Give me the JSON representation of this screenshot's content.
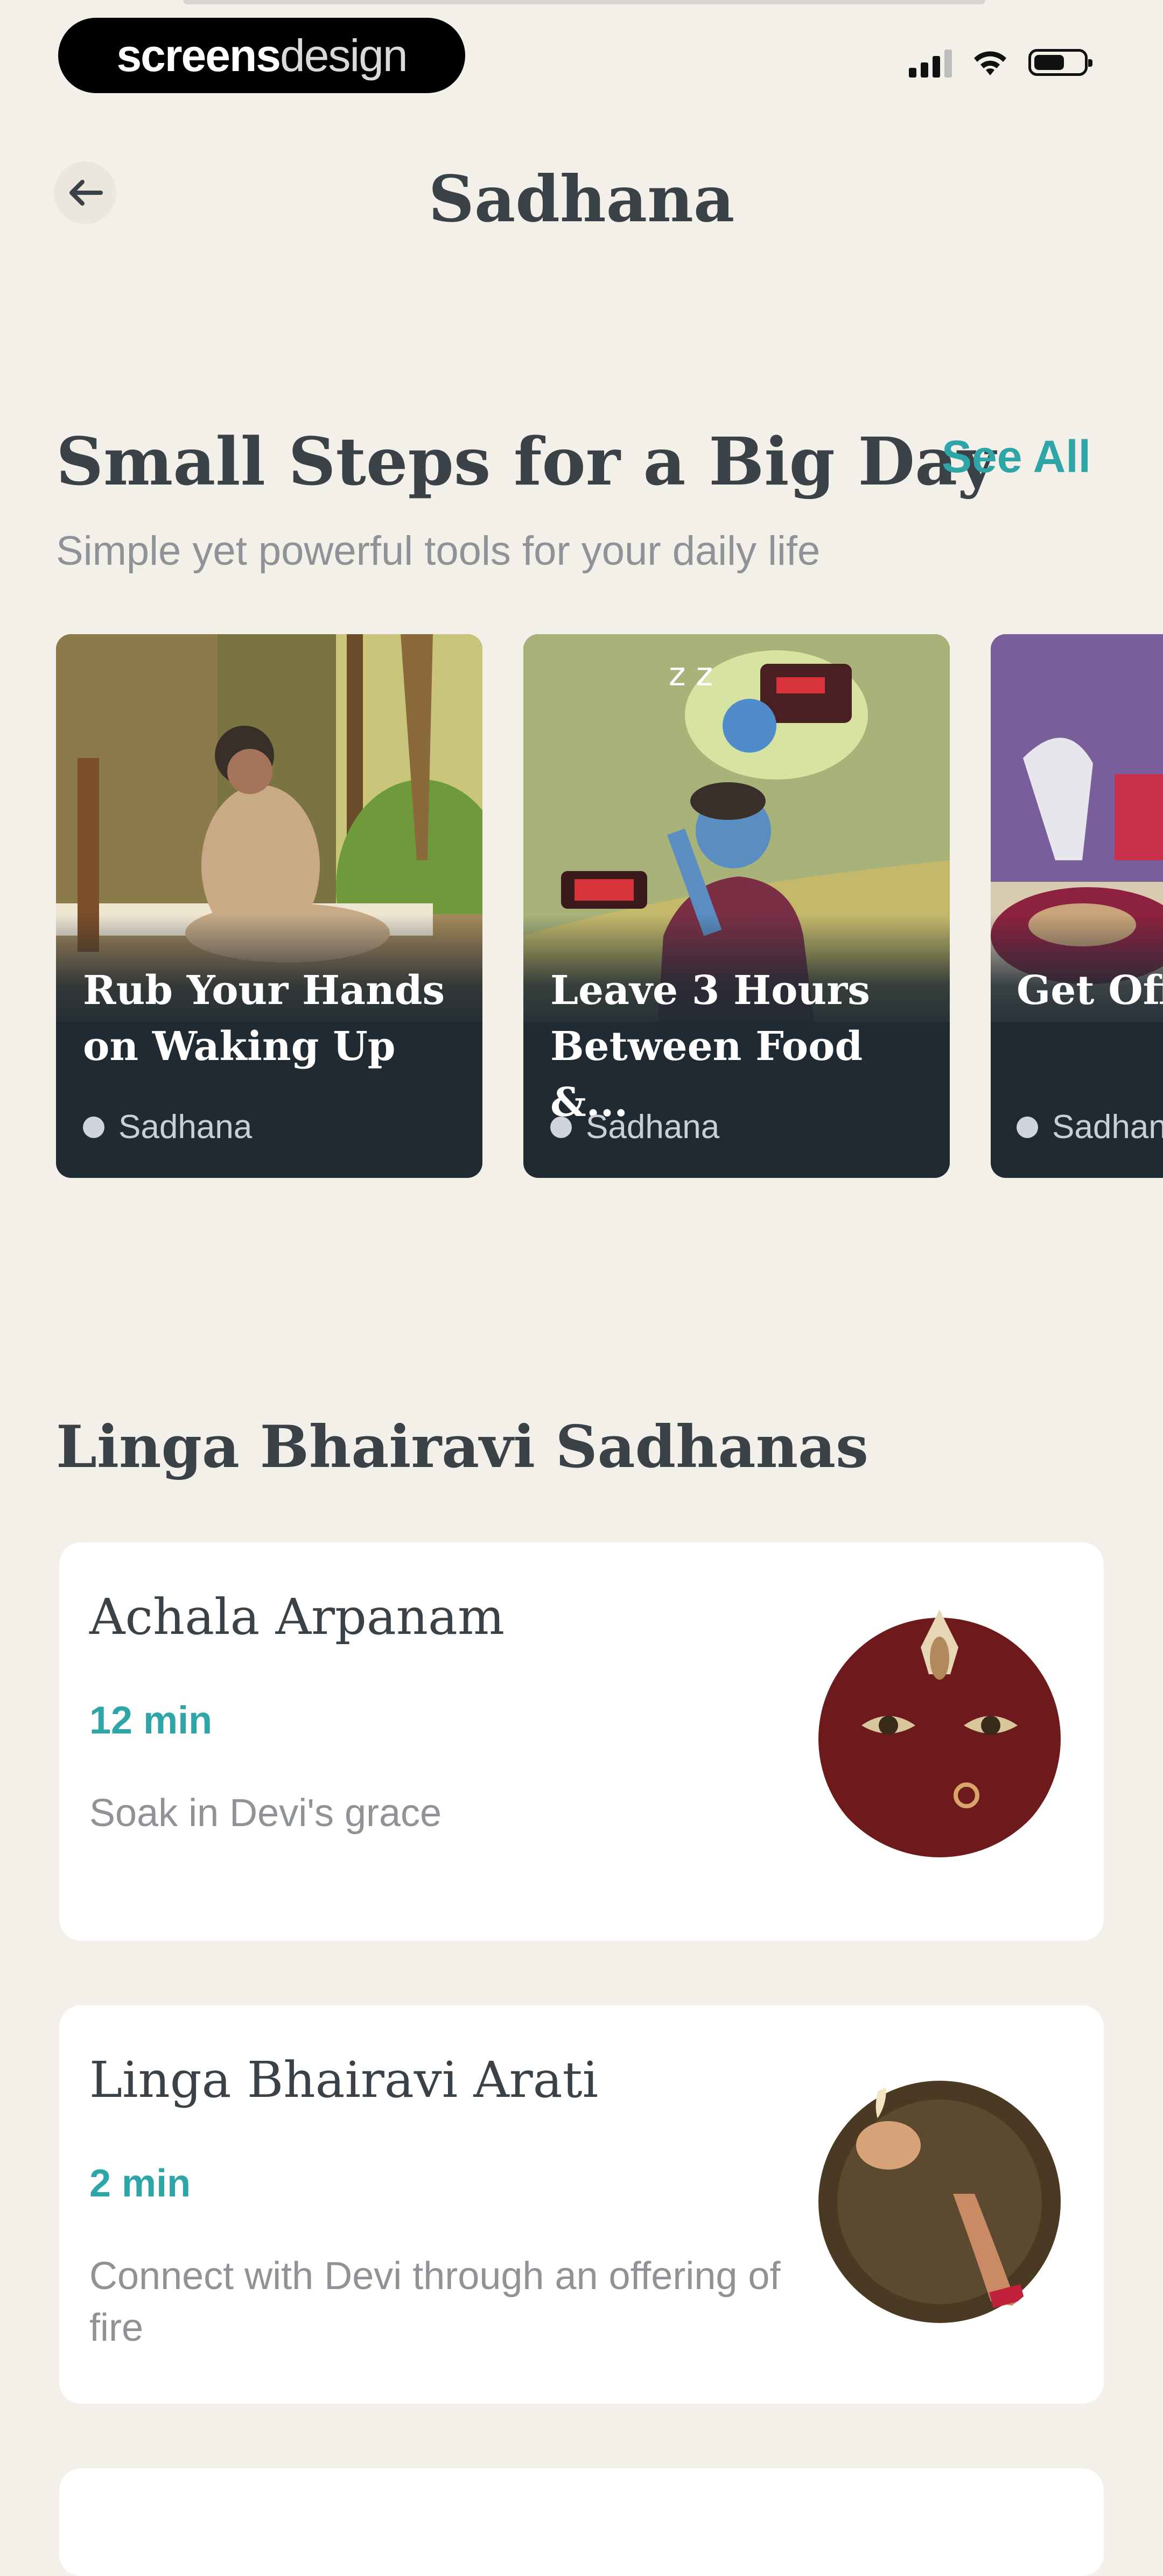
{
  "status_bar": {
    "brand_bold": "screens",
    "brand_light": "design"
  },
  "header": {
    "back_icon": "arrow-left-icon",
    "title": "Sadhana"
  },
  "small_steps": {
    "title": "Small Steps for a Big Day",
    "see_all": "See All",
    "subtitle": "Simple yet powerful tools for your daily life",
    "cards": [
      {
        "title": "Rub Your Hands\non Waking Up",
        "tag": "Sadhana"
      },
      {
        "title": "Leave 3 Hours\nBetween Food &...",
        "tag": "Sadhana"
      },
      {
        "title": "Get Off",
        "tag": "Sadhan"
      }
    ]
  },
  "linga_bhairavi": {
    "title": "Linga Bhairavi Sadhanas",
    "items": [
      {
        "name": "Achala Arpanam",
        "duration": "12 min",
        "description": "Soak in Devi's grace"
      },
      {
        "name": "Linga Bhairavi Arati",
        "duration": "2 min",
        "description": "Connect with Devi through an offering of fire"
      }
    ]
  },
  "colors": {
    "background": "#f3f0e9",
    "accent": "#2ea6a8",
    "card_dark": "#1f2a33",
    "heading": "#3a4147"
  }
}
